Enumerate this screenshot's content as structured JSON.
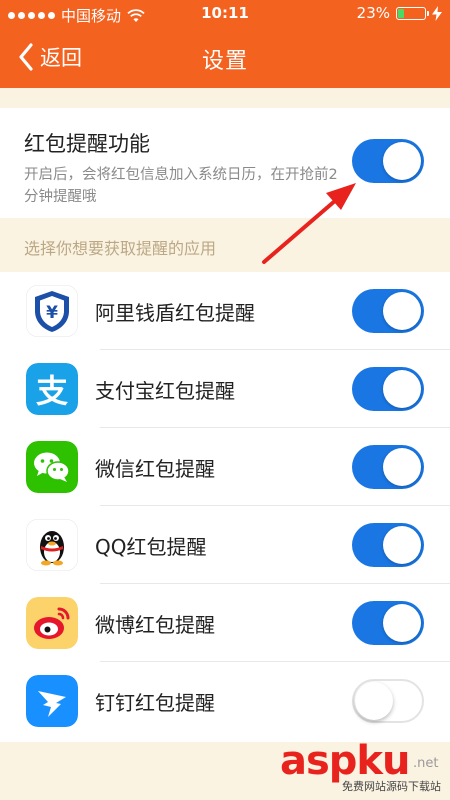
{
  "status_bar": {
    "carrier": "中国移动",
    "time": "10:11",
    "battery_percent": "23%",
    "battery_level": 0.23,
    "wifi_icon": "wifi-icon",
    "charging_icon": "charging-icon"
  },
  "nav": {
    "back_label": "返回",
    "title": "设置"
  },
  "master_setting": {
    "title": "红包提醒功能",
    "description": "开启后，会将红包信息加入系统日历，在开抢前2分钟提醒哦",
    "enabled": true
  },
  "section_hint": "选择你想要获取提醒的应用",
  "apps": [
    {
      "name": "阿里钱盾红包提醒",
      "icon": "alibaba-qiandun-shield-icon",
      "enabled": true
    },
    {
      "name": "支付宝红包提醒",
      "icon": "alipay-icon",
      "enabled": true
    },
    {
      "name": "微信红包提醒",
      "icon": "wechat-icon",
      "enabled": true
    },
    {
      "name": "QQ红包提醒",
      "icon": "qq-penguin-icon",
      "enabled": true
    },
    {
      "name": "微博红包提醒",
      "icon": "weibo-icon",
      "enabled": true
    },
    {
      "name": "钉钉红包提醒",
      "icon": "dingtalk-icon",
      "enabled": false
    }
  ],
  "colors": {
    "brand_orange": "#f4621f",
    "toggle_on": "#1976e2",
    "annotation_red": "#e8231d"
  },
  "watermark": {
    "logo": "aspku",
    "domain_suffix": ".net",
    "tagline": "免费网站源码下载站"
  }
}
